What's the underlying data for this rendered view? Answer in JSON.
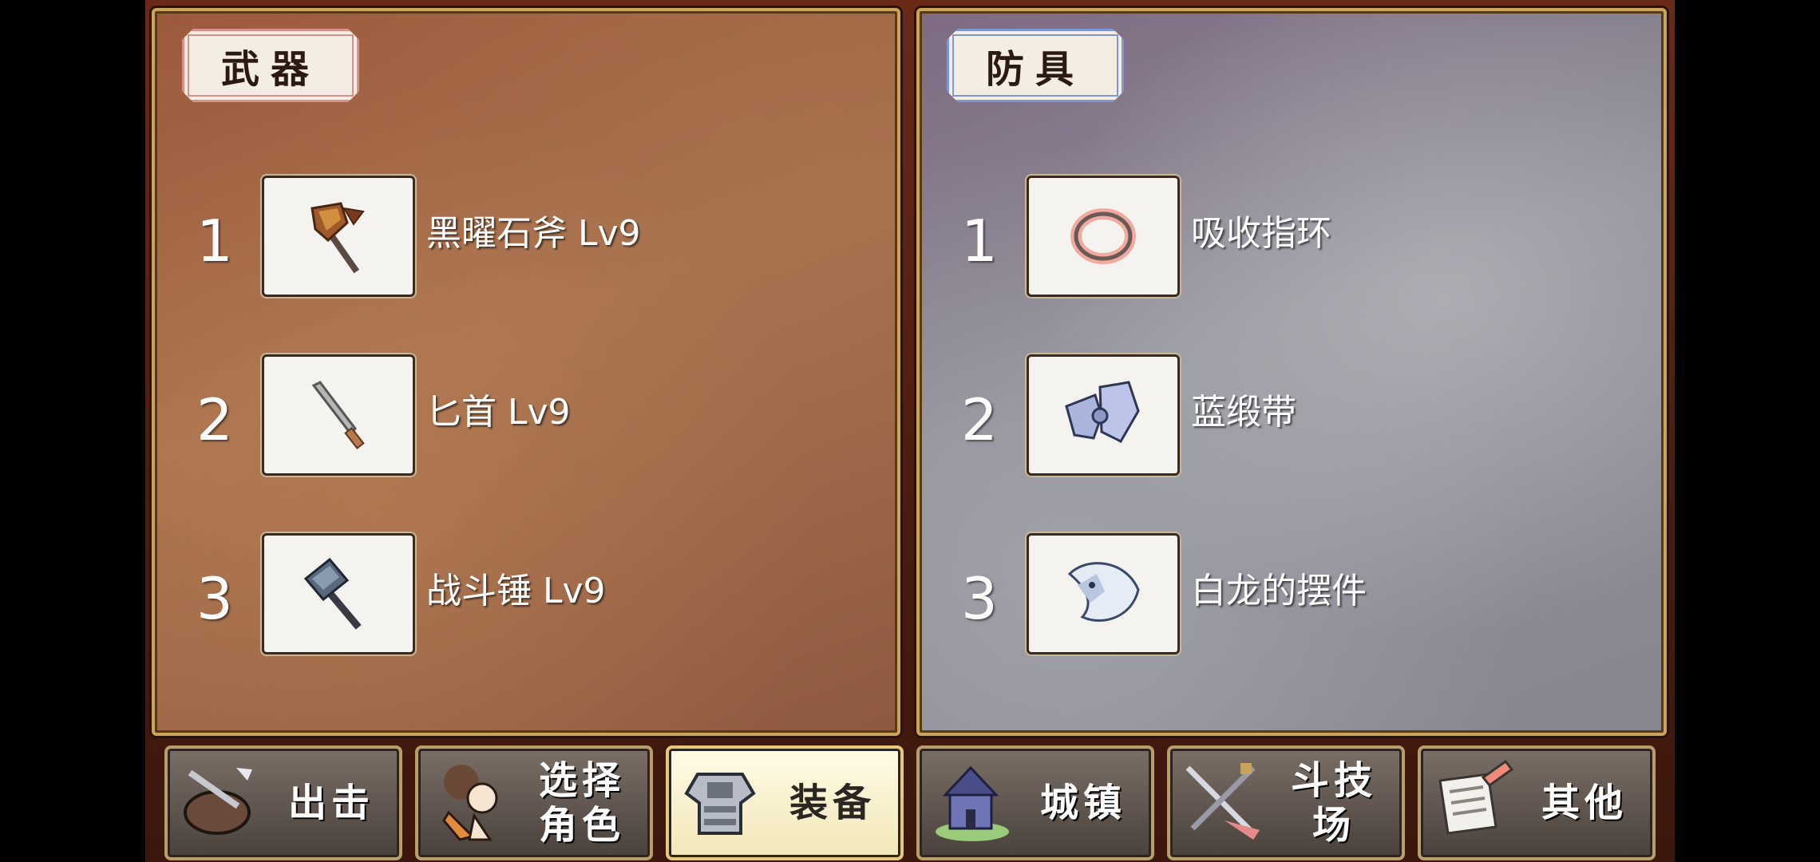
{
  "weapons": {
    "header": "武器",
    "items": [
      {
        "number": "1",
        "name": "黑曜石斧 Lv9",
        "icon": "axe-icon"
      },
      {
        "number": "2",
        "name": "匕首 Lv9",
        "icon": "dagger-icon"
      },
      {
        "number": "3",
        "name": "战斗锤 Lv9",
        "icon": "hammer-icon"
      }
    ]
  },
  "armor": {
    "header": "防具",
    "items": [
      {
        "number": "1",
        "name": "吸收指环",
        "icon": "ring-icon"
      },
      {
        "number": "2",
        "name": "蓝缎带",
        "icon": "ribbon-icon"
      },
      {
        "number": "3",
        "name": "白龙的摆件",
        "icon": "dragon-figurine-icon"
      }
    ]
  },
  "nav": [
    {
      "label": "出击",
      "icon": "sortie-icon"
    },
    {
      "label": "选择\n角色",
      "icon": "character-select-icon"
    },
    {
      "label": "装备",
      "icon": "equipment-icon",
      "active": true
    },
    {
      "label": "城镇",
      "icon": "town-icon"
    },
    {
      "label": "斗技场",
      "icon": "arena-icon"
    },
    {
      "label": "其他",
      "icon": "other-icon"
    }
  ],
  "colors": {
    "weapons_panel": "#9c5a3c",
    "armor_panel": "#868690",
    "frame_gold": "#c9a45a",
    "active_button": "#fffbe6"
  }
}
